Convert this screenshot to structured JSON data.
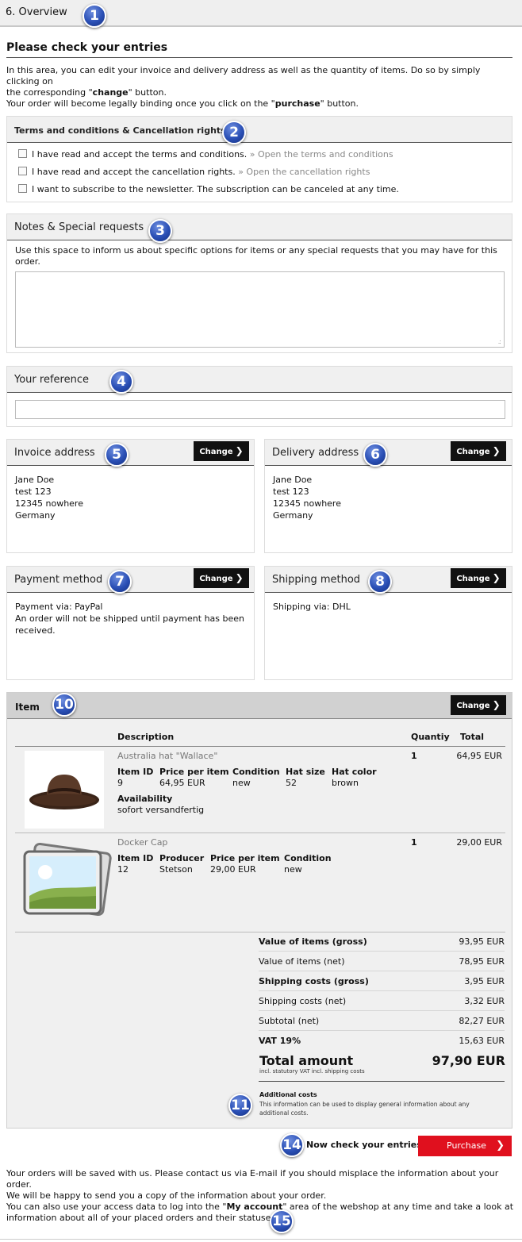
{
  "step": {
    "title": "6. Overview"
  },
  "page": {
    "title": "Please check your entries",
    "intro_1": "In this area, you can edit your invoice and delivery address as well as the quantity of items. Do so by simply clicking on",
    "intro_2a": "the corresponding \"",
    "intro_2b": "change",
    "intro_2c": "\" button.",
    "intro_3a": "Your order will become legally binding once you click on the \"",
    "intro_3b": "purchase",
    "intro_3c": "\" button."
  },
  "terms": {
    "title": "Terms and conditions & Cancellation rights",
    "terms_label": "I have read and accept the terms and conditions.",
    "terms_link": "» Open the terms and conditions",
    "cancel_label": "I have read and accept the cancellation rights.",
    "cancel_link": "» Open the cancellation rights",
    "newsletter_label": "I want to subscribe to the newsletter. The subscription can be canceled at any time."
  },
  "notes": {
    "title": "Notes & Special requests",
    "text": "Use this space to inform us about specific options for items or any special requests that you may have for this order.",
    "value": ""
  },
  "reference": {
    "title": "Your reference",
    "value": ""
  },
  "invoice": {
    "title": "Invoice address",
    "change": "Change",
    "lines": [
      "Jane Doe",
      "test 123",
      "12345 nowhere",
      "Germany"
    ]
  },
  "delivery": {
    "title": "Delivery address",
    "change": "Change",
    "lines": [
      "Jane Doe",
      "test 123",
      "12345 nowhere",
      "Germany"
    ]
  },
  "payment": {
    "title": "Payment method",
    "change": "Change",
    "line1": "Payment via: PayPal",
    "line2": "An order will not be shipped until payment has been received."
  },
  "shipping": {
    "title": "Shipping method",
    "change": "Change",
    "line1": "Shipping via: DHL"
  },
  "items": {
    "title": "Item",
    "change": "Change",
    "headers": {
      "description": "Description",
      "quantity": "Quantiy",
      "total": "Total"
    },
    "rows": [
      {
        "name": "Australia hat \"Wallace\"",
        "quantity": "1",
        "total": "64,95 EUR",
        "attrs": [
          {
            "label": "Item ID",
            "value": "9"
          },
          {
            "label": "Price per item",
            "value": "64,95 EUR"
          },
          {
            "label": "Condition",
            "value": "new"
          },
          {
            "label": "Hat size",
            "value": "52"
          },
          {
            "label": "Hat color",
            "value": "brown"
          }
        ],
        "availability_label": "Availability",
        "availability_value": "sofort versandfertig"
      },
      {
        "name": "Docker Cap",
        "quantity": "1",
        "total": "29,00 EUR",
        "attrs": [
          {
            "label": "Item ID",
            "value": "12"
          },
          {
            "label": "Producer",
            "value": "Stetson"
          },
          {
            "label": "Price per item",
            "value": "29,00 EUR"
          },
          {
            "label": "Condition",
            "value": "new"
          }
        ]
      }
    ],
    "summary": [
      {
        "label": "Value of items (gross)",
        "value": "93,95 EUR"
      },
      {
        "label": "Value of items (net)",
        "value": "78,95 EUR"
      },
      {
        "label": "Shipping costs (gross)",
        "value": "3,95 EUR"
      },
      {
        "label": "Shipping costs (net)",
        "value": "3,32 EUR"
      },
      {
        "label": "Subtotal (net)",
        "value": "82,27 EUR"
      },
      {
        "label": "VAT 19%",
        "value": "15,63 EUR"
      }
    ],
    "total_label": "Total amount",
    "total_value": "97,90 EUR",
    "total_sub": "incl. statutory VAT incl. shipping costs",
    "additional_title": "Additional costs",
    "additional_text": "This information can be used to display general information about any additional costs."
  },
  "purchase": {
    "check_text": "Now check your entries.",
    "button": "Purchase"
  },
  "footer": {
    "line1": "Your orders will be saved with us. Please contact us via E-mail if you should misplace the information about your order.",
    "line2": "We will be happy to send you a copy of the information about your order.",
    "line3a": "You can also use your access data to log into the \"",
    "line3b": "My account",
    "line3c": "\" area of the webshop at any time and take a look at",
    "line4": "information about all of your placed orders and their statuses."
  },
  "badges": [
    "1",
    "2",
    "3",
    "4",
    "5",
    "6",
    "7",
    "8",
    "10",
    "11",
    "14",
    "15"
  ],
  "colors": {
    "accent_red": "#e0101e",
    "button_black": "#111111",
    "badge_blue": "#2a4fb5"
  }
}
